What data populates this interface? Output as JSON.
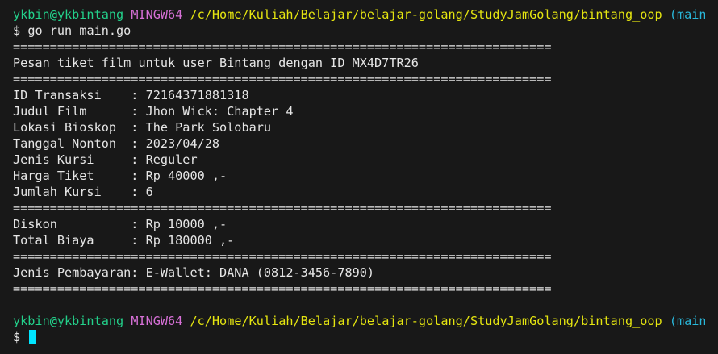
{
  "prompt": {
    "user": "ykbin@ykbintang",
    "host": "MINGW64",
    "path": "/c/Home/Kuliah/Belajar/belajar-golang/StudyJamGolang/bintang_oop",
    "branch": "(main)",
    "symbol": "$"
  },
  "command": "go run main.go",
  "separator": "=========================================================================",
  "header_text": "Pesan tiket film untuk user Bintang dengan ID MX4D7TR26",
  "details": [
    "ID Transaksi    : 72164371881318",
    "Judul Film      : Jhon Wick: Chapter 4",
    "Lokasi Bioskop  : The Park Solobaru",
    "Tanggal Nonton  : 2023/04/28",
    "Jenis Kursi     : Reguler",
    "Harga Tiket     : Rp 40000 ,-",
    "Jumlah Kursi    : 6"
  ],
  "totals": [
    "Diskon          : Rp 10000 ,-",
    "Total Biaya     : Rp 180000 ,-"
  ],
  "payment": "Jenis Pembayaran: E-Wallet: DANA (0812-3456-7890)",
  "colors": {
    "background": "#181818",
    "text": "#e6e6e6",
    "user": "#23d18b",
    "host": "#d670d6",
    "path": "#e5e510",
    "branch": "#29b8db",
    "cursor": "#00e5ff"
  }
}
